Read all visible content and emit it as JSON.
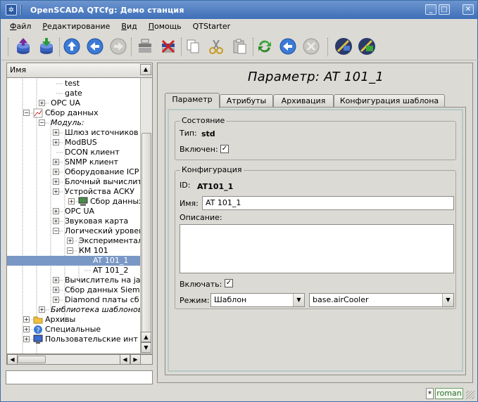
{
  "window": {
    "title": "OpenSCADA QTCfg: Демо станция"
  },
  "menu": {
    "items": [
      {
        "label": "Файл",
        "u": "Ф",
        "rest": "айл"
      },
      {
        "label": "Редактирование",
        "u": "Р",
        "rest": "едактирование"
      },
      {
        "label": "Вид",
        "u": "В",
        "rest": "ид"
      },
      {
        "label": "Помощь",
        "u": "П",
        "rest": "омощь"
      },
      {
        "label": "QTStarter",
        "u": "",
        "rest": "QTStarter"
      }
    ]
  },
  "toolbar": {
    "icons": [
      "db-load-icon",
      "db-save-icon",
      "up-icon",
      "back-icon",
      "forward-icon",
      "add-item-icon",
      "delete-item-icon",
      "copy-icon",
      "cut-icon",
      "paste-icon",
      "refresh-icon",
      "start-icon",
      "stop-icon",
      "qt-starter-icon",
      "qt-config-icon"
    ]
  },
  "tree": {
    "header": "Имя",
    "rows": [
      {
        "label": "test",
        "indent": 82,
        "exp": "",
        "italic": false,
        "sel": false
      },
      {
        "label": "gate",
        "indent": 82,
        "exp": "",
        "italic": false,
        "sel": false
      },
      {
        "label": "OPC UA",
        "indent": 62,
        "exp": "+",
        "italic": false,
        "sel": false
      },
      {
        "label": "Сбор данных",
        "indent": 40,
        "exp": "-",
        "italic": false,
        "sel": false,
        "icon": "chart-icon"
      },
      {
        "label": "Модуль:",
        "indent": 62,
        "exp": "-",
        "italic": true,
        "sel": false
      },
      {
        "label": "Шлюз источников д",
        "indent": 82,
        "exp": "+",
        "italic": false,
        "sel": false
      },
      {
        "label": "ModBUS",
        "indent": 82,
        "exp": "+",
        "italic": false,
        "sel": false
      },
      {
        "label": "DCON клиент",
        "indent": 82,
        "exp": "",
        "italic": false,
        "sel": false
      },
      {
        "label": "SNMP клиент",
        "indent": 82,
        "exp": "+",
        "italic": false,
        "sel": false
      },
      {
        "label": "Оборудование ICP",
        "indent": 82,
        "exp": "+",
        "italic": false,
        "sel": false
      },
      {
        "label": "Блочный вычислите",
        "indent": 82,
        "exp": "+",
        "italic": false,
        "sel": false
      },
      {
        "label": "Устройства АСКУ",
        "indent": 82,
        "exp": "+",
        "italic": false,
        "sel": false
      },
      {
        "label": "Сбор данных с",
        "indent": 104,
        "exp": "+",
        "italic": false,
        "sel": false,
        "icon": "computer-icon"
      },
      {
        "label": "OPC UA",
        "indent": 82,
        "exp": "+",
        "italic": false,
        "sel": false
      },
      {
        "label": "Звуковая карта",
        "indent": 82,
        "exp": "+",
        "italic": false,
        "sel": false
      },
      {
        "label": "Логический уровен",
        "indent": 82,
        "exp": "-",
        "italic": false,
        "sel": false
      },
      {
        "label": "Эксперименталь",
        "indent": 102,
        "exp": "+",
        "italic": false,
        "sel": false
      },
      {
        "label": "КМ 101",
        "indent": 102,
        "exp": "-",
        "italic": false,
        "sel": false
      },
      {
        "label": "AT 101_1",
        "indent": 122,
        "exp": "",
        "italic": false,
        "sel": true
      },
      {
        "label": "AT 101_2",
        "indent": 122,
        "exp": "",
        "italic": false,
        "sel": false
      },
      {
        "label": "Вычислитель на jav",
        "indent": 82,
        "exp": "+",
        "italic": false,
        "sel": false
      },
      {
        "label": "Сбор данных Siem",
        "indent": 82,
        "exp": "+",
        "italic": false,
        "sel": false
      },
      {
        "label": "Diamond платы сб",
        "indent": 82,
        "exp": "+",
        "italic": false,
        "sel": false
      },
      {
        "label": "Библиотека шаблонов:",
        "indent": 62,
        "exp": "+",
        "italic": true,
        "sel": false
      },
      {
        "label": "Архивы",
        "indent": 40,
        "exp": "+",
        "italic": false,
        "sel": false,
        "icon": "folder-icon"
      },
      {
        "label": "Специальные",
        "indent": 40,
        "exp": "+",
        "italic": false,
        "sel": false,
        "icon": "help-icon"
      },
      {
        "label": "Пользовательские инт",
        "indent": 40,
        "exp": "+",
        "italic": false,
        "sel": false,
        "icon": "monitor-icon"
      }
    ]
  },
  "page": {
    "title": "Параметр: AT 101_1",
    "tabs": [
      {
        "label": "Параметр",
        "active": true
      },
      {
        "label": "Атрибуты",
        "active": false
      },
      {
        "label": "Архивация",
        "active": false
      },
      {
        "label": "Конфигурация шаблона",
        "active": false
      }
    ],
    "state": {
      "legend": "Состояние",
      "type_label": "Тип:",
      "type_value": "std",
      "enabled_label": "Включен:",
      "enabled_checked": true
    },
    "config": {
      "legend": "Конфигурация",
      "id_label": "ID:",
      "id_value": "AT101_1",
      "name_label": "Имя:",
      "name_value": "AT 101_1",
      "descr_label": "Описание:",
      "descr_value": "",
      "turnon_label": "Включать:",
      "turnon_checked": true,
      "mode_label": "Режим:",
      "mode_value": "Шаблон",
      "template_value": "base.airCooler"
    }
  },
  "status": {
    "mark": "*",
    "user": "roman"
  }
}
